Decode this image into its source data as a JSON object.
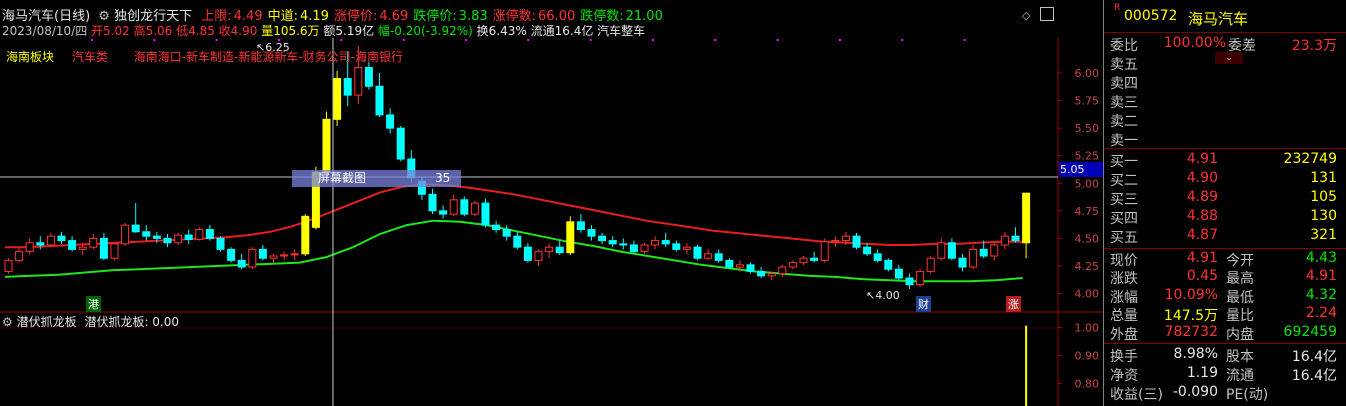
{
  "header": {
    "title": "海马汽车(日线)",
    "indicator_name": "独创龙行天下",
    "items": [
      {
        "label": "上限:",
        "value": "4.49",
        "color": "#ff3232"
      },
      {
        "label": "中道:",
        "value": "4.19",
        "color": "#ffff00"
      },
      {
        "label": "涨停价:",
        "value": "4.69",
        "color": "#ff3232"
      },
      {
        "label": "跌停价:",
        "value": "3.83",
        "color": "#00e600"
      },
      {
        "label": "涨停数:",
        "value": "66.00",
        "color": "#ff3232"
      },
      {
        "label": "跌停数:",
        "value": "21.00",
        "color": "#00e600"
      }
    ],
    "line2_date": "2023/08/10/四",
    "line2_ohlc": "开5.02 高5.06 低4.85 收4.90",
    "line2_vol": "量105.6万",
    "line2_amt": "额5.19亿",
    "line2_chg": "幅-0.20(-3.92%)",
    "line2_turn": "换6.43%",
    "line2_float": "流通16.4亿",
    "line2_sector": "汽车整车",
    "tags": [
      "海南板块",
      "汽车类",
      "海南海口-新车制造-新能源新车-财务公司-海南银行"
    ],
    "tag_colors": [
      "#ffff00",
      "#ff3232",
      "#ff3232"
    ]
  },
  "chart_labels": {
    "high_mark": "6.25",
    "low_mark": "4.00",
    "badge_gang": "港",
    "badge_cai": "财",
    "badge_zhang": "涨",
    "crosshair_price": "5.05",
    "tooltip_label": "屏幕截图",
    "tooltip_value": "35"
  },
  "sub_header": {
    "name": "潜伏抓龙板",
    "value_text": "潜伏抓龙板: 0.00"
  },
  "chart_data": {
    "type": "candlestick",
    "ylim": [
      3.85,
      6.3
    ],
    "y_ticks": [
      "6.00",
      "5.75",
      "5.50",
      "5.25",
      "5.00",
      "4.75",
      "4.50",
      "4.25",
      "4.00"
    ],
    "sub_ylim": [
      0.74,
      1.02
    ],
    "sub_y_ticks": [
      "1.00",
      "0.90",
      "0.80"
    ],
    "candles": [
      [
        4.2,
        4.32,
        4.18,
        4.3
      ],
      [
        4.3,
        4.42,
        4.28,
        4.38
      ],
      [
        4.38,
        4.5,
        4.35,
        4.46
      ],
      [
        4.46,
        4.52,
        4.4,
        4.44
      ],
      [
        4.44,
        4.55,
        4.42,
        4.52
      ],
      [
        4.52,
        4.56,
        4.45,
        4.48
      ],
      [
        4.48,
        4.52,
        4.38,
        4.4
      ],
      [
        4.4,
        4.46,
        4.35,
        4.42
      ],
      [
        4.42,
        4.54,
        4.4,
        4.5
      ],
      [
        4.5,
        4.55,
        4.3,
        4.32
      ],
      [
        4.32,
        4.46,
        4.3,
        4.45
      ],
      [
        4.45,
        4.64,
        4.43,
        4.62
      ],
      [
        4.62,
        4.82,
        4.55,
        4.56
      ],
      [
        4.56,
        4.62,
        4.48,
        4.52
      ],
      [
        4.52,
        4.56,
        4.46,
        4.5
      ],
      [
        4.5,
        4.54,
        4.42,
        4.46
      ],
      [
        4.46,
        4.55,
        4.44,
        4.53
      ],
      [
        4.53,
        4.58,
        4.45,
        4.49
      ],
      [
        4.49,
        4.6,
        4.48,
        4.58
      ],
      [
        4.58,
        4.62,
        4.48,
        4.5
      ],
      [
        4.5,
        4.52,
        4.38,
        4.4
      ],
      [
        4.4,
        4.42,
        4.28,
        4.3
      ],
      [
        4.3,
        4.36,
        4.22,
        4.24
      ],
      [
        4.24,
        4.42,
        4.22,
        4.4
      ],
      [
        4.4,
        4.44,
        4.3,
        4.32
      ],
      [
        4.32,
        4.36,
        4.28,
        4.34
      ],
      [
        4.34,
        4.38,
        4.3,
        4.35
      ],
      [
        4.35,
        4.4,
        4.3,
        4.36
      ],
      [
        4.36,
        4.72,
        4.34,
        4.7
      ],
      [
        4.6,
        5.15,
        4.58,
        5.1
      ],
      [
        5.1,
        5.65,
        5.05,
        5.58
      ],
      [
        5.58,
        6.02,
        5.52,
        5.95
      ],
      [
        5.95,
        6.2,
        5.7,
        5.8
      ],
      [
        5.8,
        6.25,
        5.72,
        6.05
      ],
      [
        6.05,
        6.1,
        5.85,
        5.88
      ],
      [
        5.88,
        6.0,
        5.6,
        5.62
      ],
      [
        5.62,
        5.68,
        5.45,
        5.5
      ],
      [
        5.5,
        5.52,
        5.2,
        5.22
      ],
      [
        5.22,
        5.3,
        5.0,
        5.05
      ],
      [
        5.02,
        5.06,
        4.85,
        4.9
      ],
      [
        4.9,
        4.95,
        4.72,
        4.75
      ],
      [
        4.75,
        4.8,
        4.68,
        4.72
      ],
      [
        4.72,
        4.9,
        4.7,
        4.85
      ],
      [
        4.85,
        4.88,
        4.7,
        4.72
      ],
      [
        4.72,
        4.84,
        4.7,
        4.82
      ],
      [
        4.82,
        4.86,
        4.6,
        4.62
      ],
      [
        4.62,
        4.66,
        4.55,
        4.58
      ],
      [
        4.58,
        4.62,
        4.48,
        4.52
      ],
      [
        4.52,
        4.56,
        4.4,
        4.42
      ],
      [
        4.42,
        4.46,
        4.28,
        4.3
      ],
      [
        4.3,
        4.4,
        4.25,
        4.38
      ],
      [
        4.38,
        4.45,
        4.32,
        4.42
      ],
      [
        4.42,
        4.48,
        4.35,
        4.37
      ],
      [
        4.37,
        4.7,
        4.35,
        4.65
      ],
      [
        4.65,
        4.72,
        4.55,
        4.58
      ],
      [
        4.58,
        4.62,
        4.48,
        4.52
      ],
      [
        4.52,
        4.55,
        4.45,
        4.48
      ],
      [
        4.48,
        4.52,
        4.42,
        4.45
      ],
      [
        4.45,
        4.5,
        4.4,
        4.44
      ],
      [
        4.44,
        4.48,
        4.36,
        4.38
      ],
      [
        4.38,
        4.46,
        4.36,
        4.44
      ],
      [
        4.44,
        4.52,
        4.4,
        4.48
      ],
      [
        4.48,
        4.55,
        4.42,
        4.45
      ],
      [
        4.45,
        4.48,
        4.38,
        4.4
      ],
      [
        4.4,
        4.46,
        4.36,
        4.42
      ],
      [
        4.42,
        4.44,
        4.3,
        4.32
      ],
      [
        4.32,
        4.4,
        4.3,
        4.36
      ],
      [
        4.36,
        4.4,
        4.28,
        4.3
      ],
      [
        4.3,
        4.32,
        4.22,
        4.24
      ],
      [
        4.24,
        4.3,
        4.2,
        4.26
      ],
      [
        4.26,
        4.28,
        4.18,
        4.2
      ],
      [
        4.2,
        4.24,
        4.14,
        4.16
      ],
      [
        4.16,
        4.2,
        4.12,
        4.18
      ],
      [
        4.18,
        4.26,
        4.15,
        4.24
      ],
      [
        4.24,
        4.3,
        4.22,
        4.28
      ],
      [
        4.28,
        4.34,
        4.26,
        4.32
      ],
      [
        4.32,
        4.38,
        4.28,
        4.3
      ],
      [
        4.3,
        4.5,
        4.28,
        4.47
      ],
      [
        4.47,
        4.52,
        4.42,
        4.48
      ],
      [
        4.48,
        4.56,
        4.44,
        4.52
      ],
      [
        4.52,
        4.55,
        4.4,
        4.42
      ],
      [
        4.42,
        4.46,
        4.34,
        4.36
      ],
      [
        4.36,
        4.4,
        4.28,
        4.3
      ],
      [
        4.3,
        4.32,
        4.2,
        4.22
      ],
      [
        4.22,
        4.26,
        4.12,
        4.14
      ],
      [
        4.14,
        4.18,
        4.04,
        4.08
      ],
      [
        4.08,
        4.22,
        4.06,
        4.2
      ],
      [
        4.2,
        4.34,
        4.18,
        4.32
      ],
      [
        4.32,
        4.5,
        4.3,
        4.46
      ],
      [
        4.46,
        4.5,
        4.3,
        4.32
      ],
      [
        4.32,
        4.36,
        4.2,
        4.24
      ],
      [
        4.24,
        4.44,
        4.22,
        4.4
      ],
      [
        4.4,
        4.48,
        4.32,
        4.34
      ],
      [
        4.34,
        4.46,
        4.3,
        4.44
      ],
      [
        4.44,
        4.56,
        4.4,
        4.52
      ],
      [
        4.52,
        4.6,
        4.46,
        4.48
      ],
      [
        4.46,
        4.91,
        4.32,
        4.91
      ]
    ],
    "ma_upper": [
      4.42,
      4.42,
      4.43,
      4.44,
      4.45,
      4.46,
      4.47,
      4.48,
      4.49,
      4.5,
      4.51,
      4.53,
      4.56,
      4.61,
      4.68,
      4.76,
      4.84,
      4.92,
      4.97,
      4.99,
      4.98,
      4.96,
      4.93,
      4.9,
      4.86,
      4.82,
      4.78,
      4.74,
      4.7,
      4.66,
      4.63,
      4.6,
      4.57,
      4.55,
      4.53,
      4.51,
      4.49,
      4.47,
      4.46,
      4.45,
      4.44,
      4.44,
      4.45,
      4.45,
      4.46,
      4.47,
      4.47
    ],
    "ma_lower": [
      4.15,
      4.16,
      4.17,
      4.19,
      4.21,
      4.22,
      4.23,
      4.24,
      4.25,
      4.26,
      4.27,
      4.28,
      4.33,
      4.42,
      4.54,
      4.62,
      4.66,
      4.65,
      4.62,
      4.57,
      4.52,
      4.47,
      4.43,
      4.38,
      4.34,
      4.3,
      4.26,
      4.23,
      4.2,
      4.18,
      4.16,
      4.15,
      4.13,
      4.12,
      4.11,
      4.11,
      4.11,
      4.12,
      4.14
    ]
  },
  "quote": {
    "code_prefix": "R",
    "code": "000572",
    "name": "海马汽车",
    "weibi_label": "委比",
    "weibi_value": "100.00%",
    "weicha_label": "委差",
    "weicha_value": "23.3万",
    "sells": [
      {
        "label": "卖五",
        "price": "",
        "vol": ""
      },
      {
        "label": "卖四",
        "price": "",
        "vol": ""
      },
      {
        "label": "卖三",
        "price": "",
        "vol": ""
      },
      {
        "label": "卖二",
        "price": "",
        "vol": ""
      },
      {
        "label": "卖一",
        "price": "",
        "vol": ""
      }
    ],
    "buys": [
      {
        "label": "买一",
        "price": "4.91",
        "vol": "232749"
      },
      {
        "label": "买二",
        "price": "4.90",
        "vol": "131"
      },
      {
        "label": "买三",
        "price": "4.89",
        "vol": "105"
      },
      {
        "label": "买四",
        "price": "4.88",
        "vol": "130"
      },
      {
        "label": "买五",
        "price": "4.87",
        "vol": "321"
      }
    ],
    "stats": [
      {
        "l1": "现价",
        "v1": "4.91",
        "c1": "#ff3232",
        "l2": "今开",
        "v2": "4.43",
        "c2": "#00e600"
      },
      {
        "l1": "涨跌",
        "v1": "0.45",
        "c1": "#ff3232",
        "l2": "最高",
        "v2": "4.91",
        "c2": "#ff3232"
      },
      {
        "l1": "涨幅",
        "v1": "10.09%",
        "c1": "#ff3232",
        "l2": "最低",
        "v2": "4.32",
        "c2": "#00e600"
      },
      {
        "l1": "总量",
        "v1": "147.5万",
        "c1": "#ffff00",
        "l2": "量比",
        "v2": "2.24",
        "c2": "#ff3232"
      },
      {
        "l1": "外盘",
        "v1": "782732",
        "c1": "#ff3232",
        "l2": "内盘",
        "v2": "692459",
        "c2": "#00e600"
      },
      {
        "l1": "换手",
        "v1": "8.98%",
        "c1": "#e6e6e6",
        "l2": "股本",
        "v2": "16.4亿",
        "c2": "#e6e6e6"
      },
      {
        "l1": "净资",
        "v1": "1.19",
        "c1": "#e6e6e6",
        "l2": "流通",
        "v2": "16.4亿",
        "c2": "#e6e6e6"
      },
      {
        "l1": "收益(三)",
        "v1": "-0.090",
        "c1": "#e6e6e6",
        "l2": "PE(动)",
        "v2": "",
        "c2": "#e6e6e6"
      }
    ]
  },
  "colors": {
    "up": "#ff3232",
    "down": "#00ffff",
    "limit_up": "#ffff00",
    "ma_upper": "#e61e1e",
    "ma_lower": "#1ee61e"
  }
}
